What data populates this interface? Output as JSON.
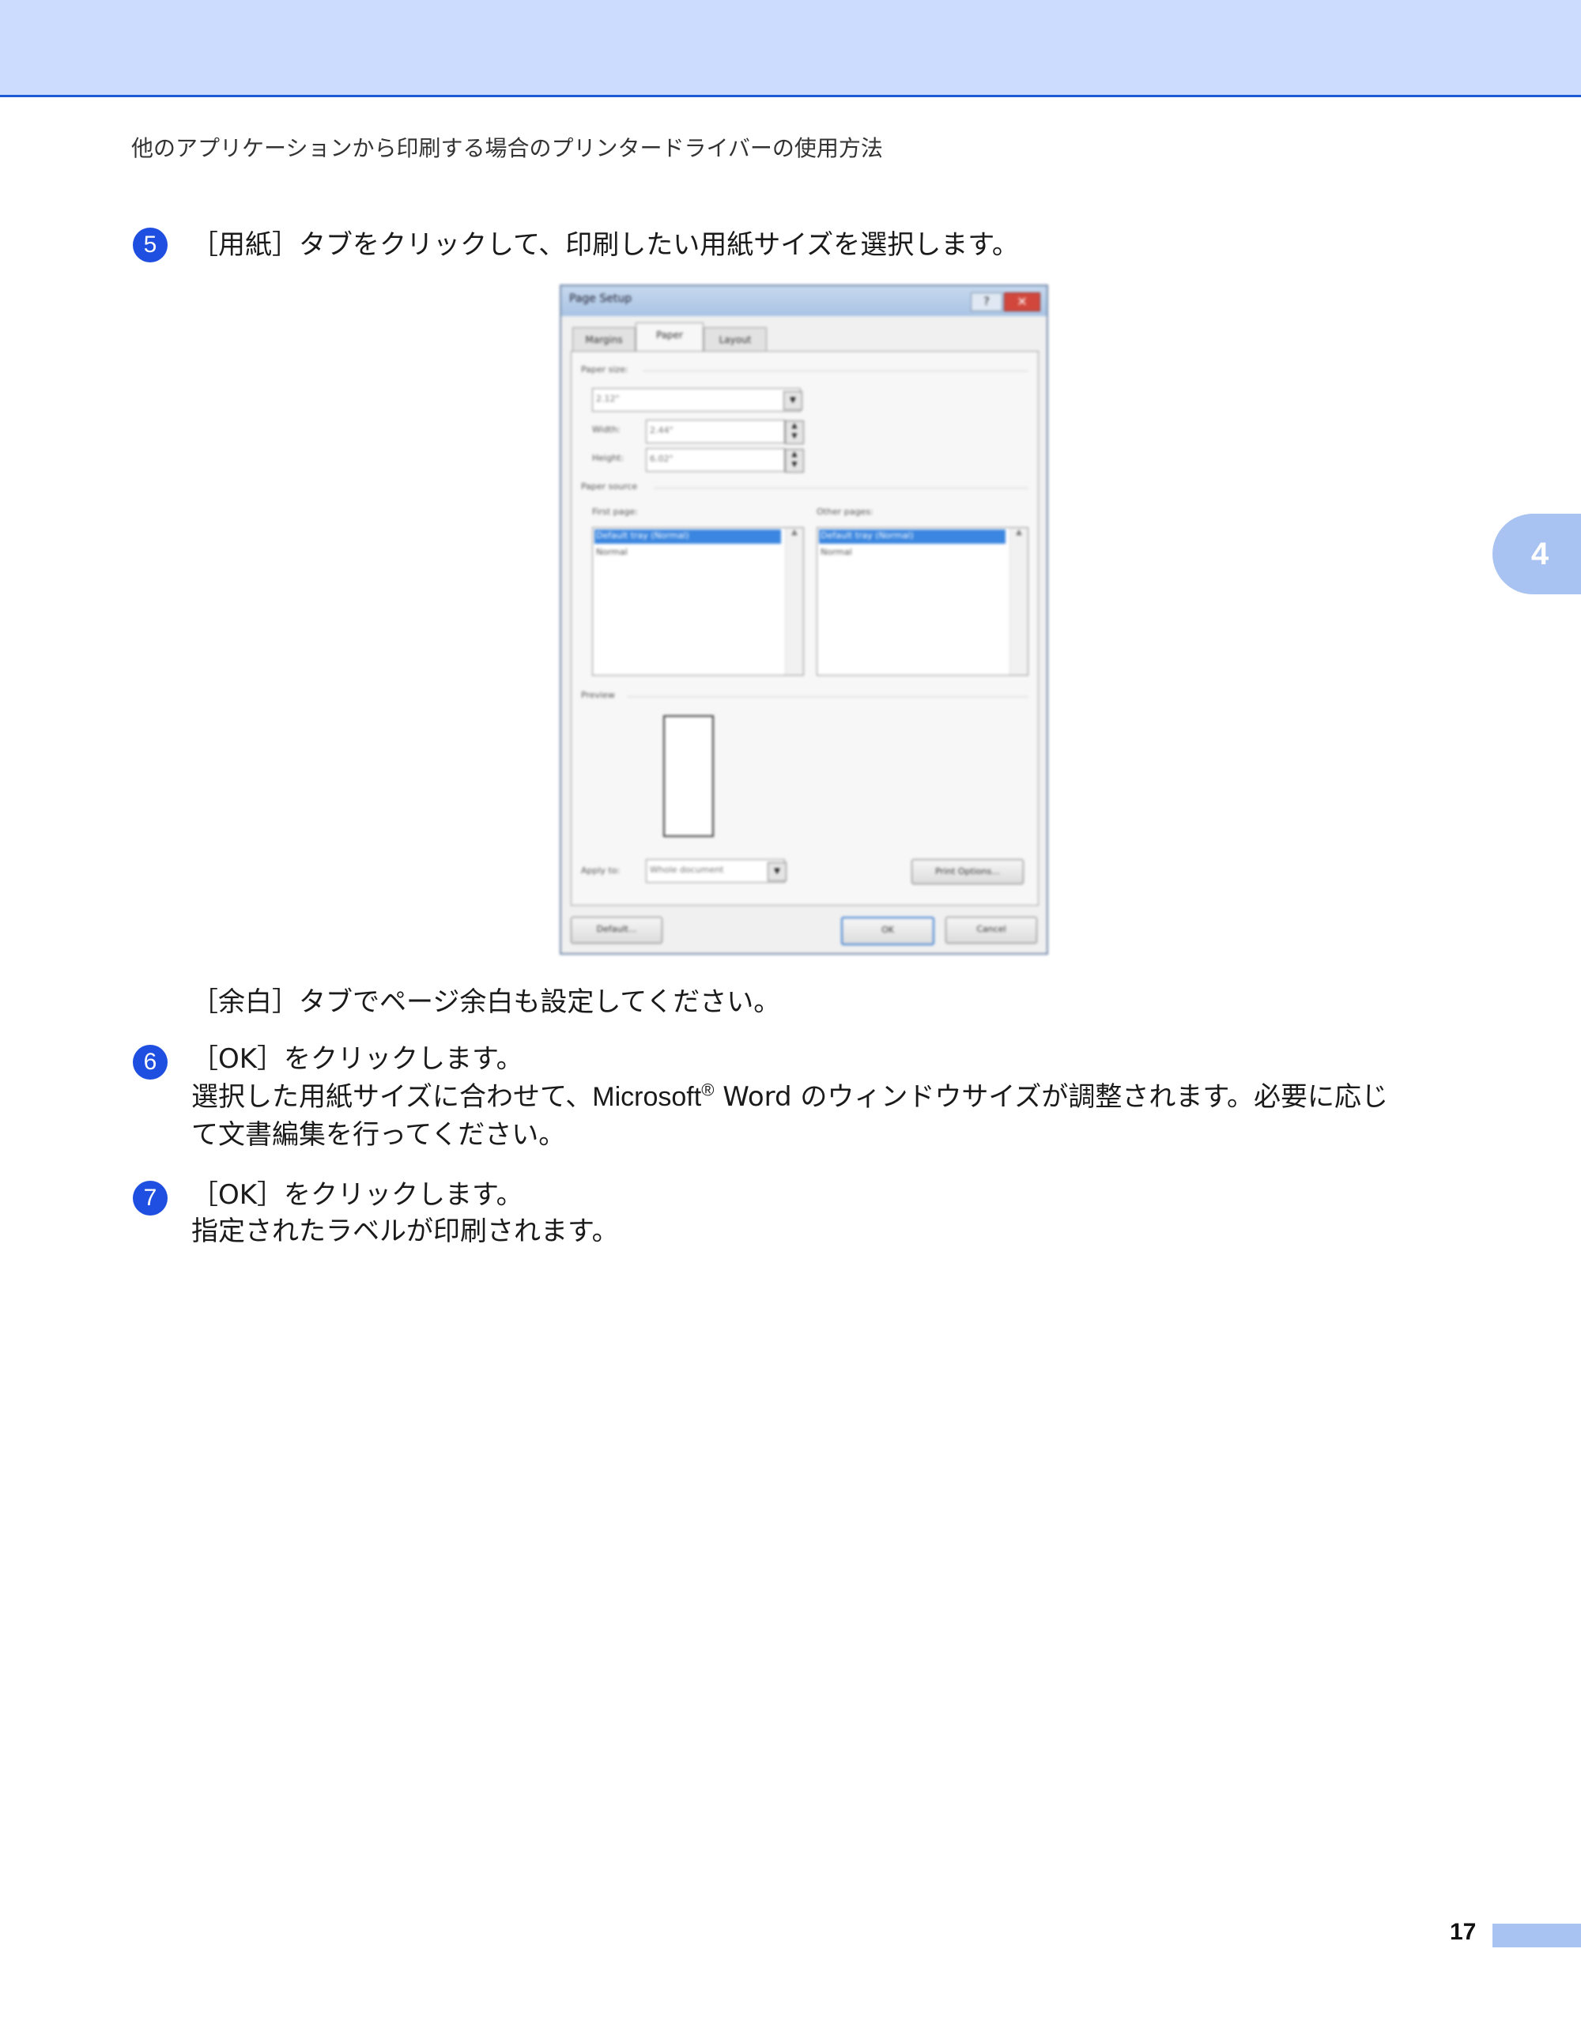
{
  "header": {
    "running_head": "他のアプリケーションから印刷する場合のプリンタードライバーの使用方法",
    "chapter_number": "4"
  },
  "steps": [
    {
      "number": "5",
      "lines": [
        "［用紙］タブをクリックして、印刷したい用紙サイズを選択します。"
      ],
      "bold": "用紙"
    },
    {
      "number": "",
      "lines": [
        "［余白］タブでページ余白も設定してください。"
      ]
    },
    {
      "number": "6",
      "line1": "［OK］をクリックします。",
      "line2_pre": "選択した用紙サイズに合わせて、",
      "line2_brand": "Microsoft",
      "line2_reg": "®",
      "line2_post": " Word のウィンドウサイズが調整されます。必要に応じ",
      "line3": "て文書編集を行ってください。"
    },
    {
      "number": "7",
      "line1": "［OK］をクリックします。",
      "line2": "指定されたラベルが印刷されます。"
    }
  ],
  "dialog": {
    "title": "Page Setup",
    "help_glyph": "?",
    "close_glyph": "✕",
    "tabs": [
      "Margins",
      "Paper",
      "Layout"
    ],
    "paper_size_label": "Paper size:",
    "paper_size_value": "2.12\"",
    "width_label": "Width:",
    "width_value": "2.44\"",
    "height_label": "Height:",
    "height_value": "6.02\"",
    "paper_source_label": "Paper source",
    "first_page_label": "First page:",
    "other_pages_label": "Other pages:",
    "first_page_items": [
      "Default tray (Normal)",
      "Normal"
    ],
    "other_pages_items": [
      "Default tray (Normal)",
      "Normal"
    ],
    "preview_label": "Preview",
    "apply_to_label": "Apply to:",
    "apply_to_value": "Whole document",
    "print_options_button": "Print Options...",
    "default_button": "Default...",
    "ok_button": "OK",
    "cancel_button": "Cancel"
  },
  "footer": {
    "page_number": "17"
  }
}
